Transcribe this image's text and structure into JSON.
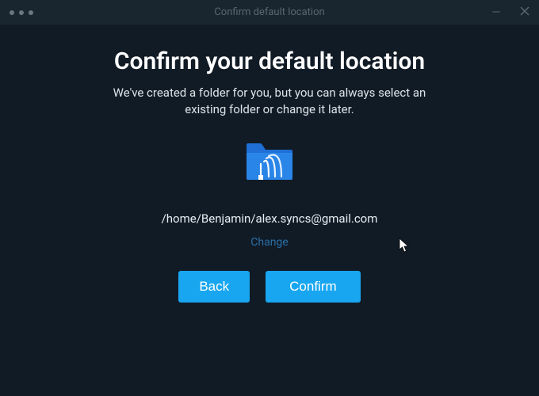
{
  "window": {
    "title": "Confirm default location"
  },
  "heading": "Confirm your default location",
  "subtext": "We've created a folder for you, but you can always select an existing folder or change it later.",
  "path": "/home/Benjamin/alex.syncs@gmail.com",
  "change_label": "Change",
  "buttons": {
    "back": "Back",
    "confirm": "Confirm"
  }
}
